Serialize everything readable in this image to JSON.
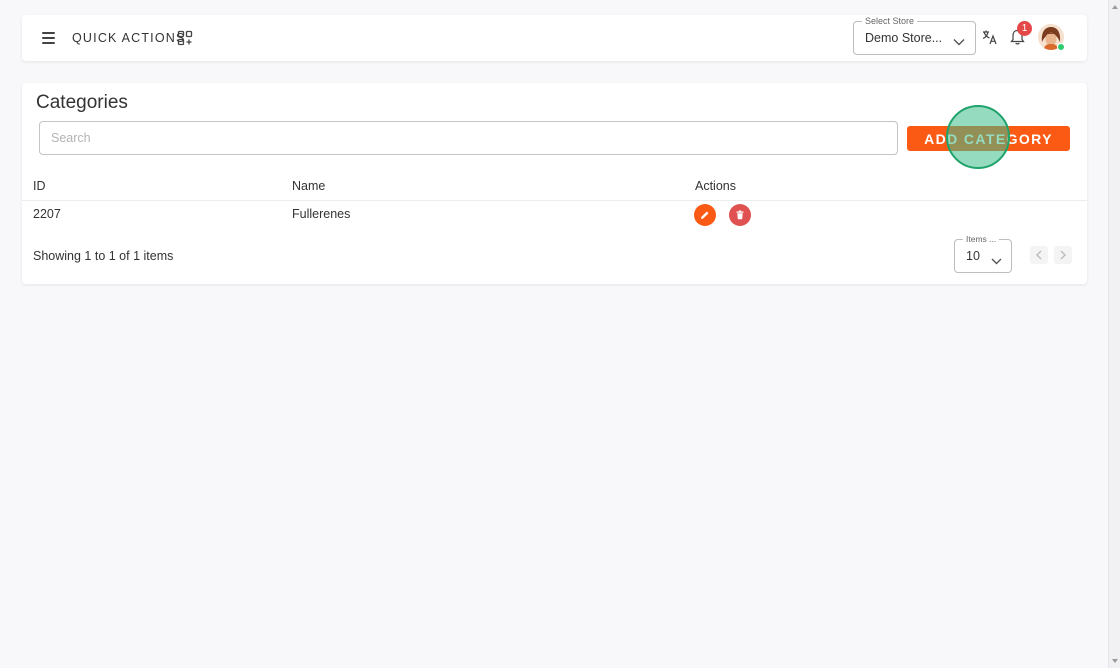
{
  "header": {
    "quick_actions_label": "QUICK ACTIONS",
    "store_select": {
      "legend": "Select Store",
      "value": "Demo Store..."
    },
    "notification_count": "1"
  },
  "categories": {
    "title": "Categories",
    "search": {
      "placeholder": "Search",
      "value": ""
    },
    "add_button_label": "ADD CATEGORY",
    "columns": [
      "ID",
      "Name",
      "Actions"
    ],
    "rows": [
      {
        "id": "2207",
        "name": "Fullerenes"
      }
    ],
    "footer": {
      "showing_text": "Showing 1 to 1 of 1 items",
      "items_per_page": {
        "legend": "Items ...",
        "value": "10"
      }
    }
  },
  "icons": {
    "menu": "menu-icon",
    "quick_actions": "grid-plus-icon",
    "translate": "translate-icon",
    "notifications": "bell-icon",
    "edit": "pencil-icon",
    "delete": "trash-icon"
  },
  "colors": {
    "accent": "#fa5a14",
    "delete": "#e05252",
    "badge": "#e54848",
    "online": "#2ecc71",
    "click_indicator": "#1fa36b"
  }
}
